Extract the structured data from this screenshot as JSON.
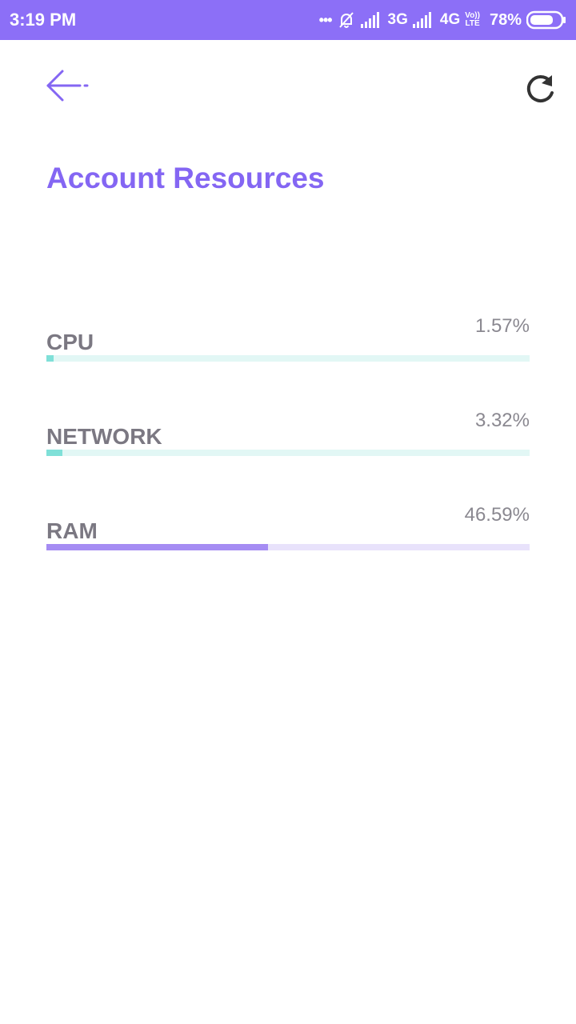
{
  "status_bar": {
    "time": "3:19 PM",
    "dots": "•••",
    "net1": "3G",
    "net2": "4G",
    "volte_top": "Vo))",
    "volte_bottom": "LTE",
    "battery": "78%",
    "battery_level": 0.78
  },
  "header": {
    "title": "Account Resources"
  },
  "resources": [
    {
      "label": "CPU",
      "value": "1.57%",
      "level": 0.0157,
      "color": "teal"
    },
    {
      "label": "NETWORK",
      "value": "3.32%",
      "level": 0.0332,
      "color": "teal"
    },
    {
      "label": "RAM",
      "value": "46.59%",
      "level": 0.4659,
      "color": "purple"
    }
  ],
  "colors": {
    "accent": "#8466f3",
    "status_bar": "#8c6ff7",
    "teal_fill": "#7fe0d8",
    "teal_track": "#e2f7f5",
    "purple_fill": "#a58cf3",
    "purple_track": "#e8e2fb"
  },
  "icons": {
    "back": "arrow-left-icon",
    "refresh": "refresh-icon"
  }
}
